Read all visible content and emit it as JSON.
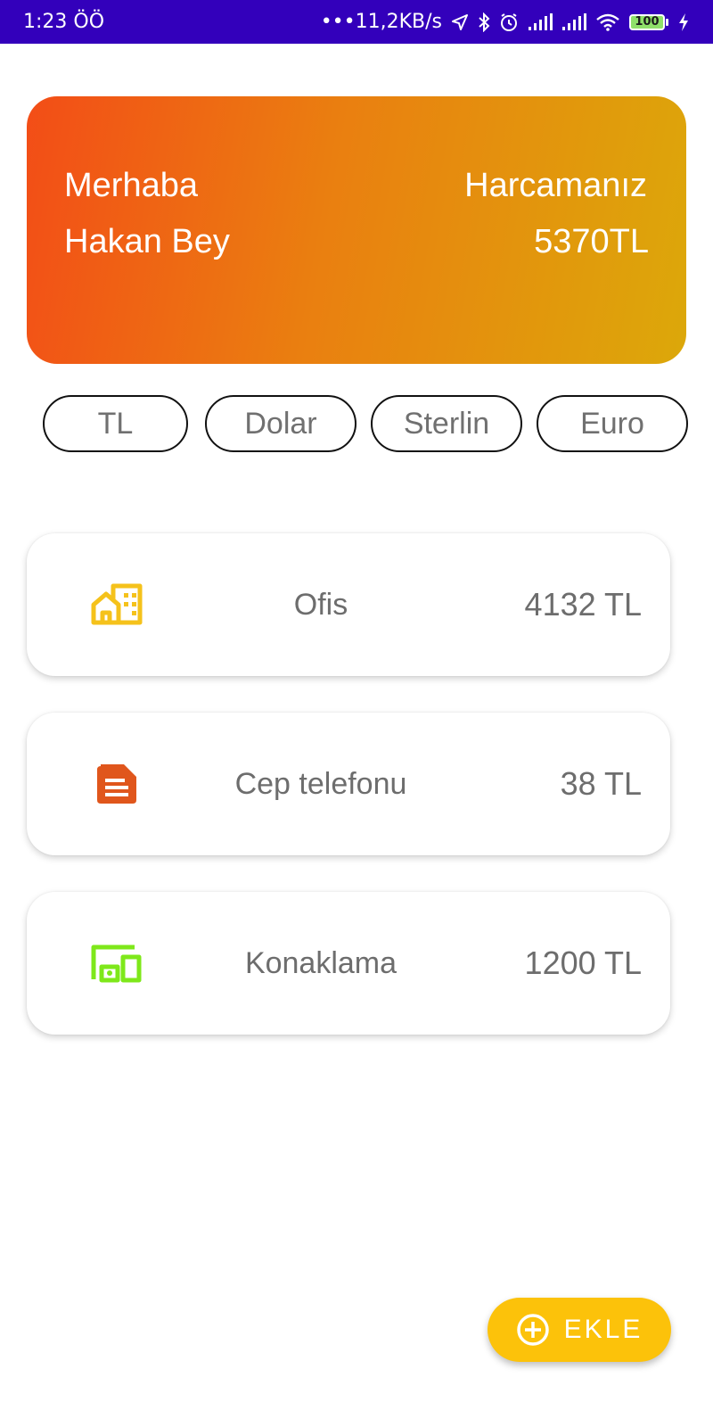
{
  "status_bar": {
    "time": "1:23 ÖÖ",
    "network_speed": "•••11,2KB/s",
    "battery_level": "100",
    "icons": [
      "location-arrow-icon",
      "bluetooth-icon",
      "alarm-icon",
      "signal-icon",
      "signal-icon",
      "wifi-icon",
      "battery-icon",
      "charging-icon"
    ]
  },
  "header_card": {
    "greeting": "Merhaba",
    "user_name": "Hakan Bey",
    "spending_label": "Harcamanız",
    "spending_total": "5370TL",
    "gradient_colors": [
      "#f34d17",
      "#ea7f10",
      "#dca80a"
    ]
  },
  "currencies": {
    "options": [
      "TL",
      "Dolar",
      "Sterlin",
      "Euro"
    ]
  },
  "expenses": [
    {
      "name": "Ofis",
      "amount": "4132 TL",
      "icon": "office-building-icon",
      "icon_color": "#f5c21b"
    },
    {
      "name": "Cep telefonu",
      "amount": "38 TL",
      "icon": "document-icon",
      "icon_color": "#e0561c"
    },
    {
      "name": "Konaklama",
      "amount": "1200 TL",
      "icon": "devices-icon",
      "icon_color": "#7ee81a"
    }
  ],
  "fab": {
    "label": "EKLE",
    "icon": "add-circle-icon",
    "color": "#fcc20a"
  }
}
